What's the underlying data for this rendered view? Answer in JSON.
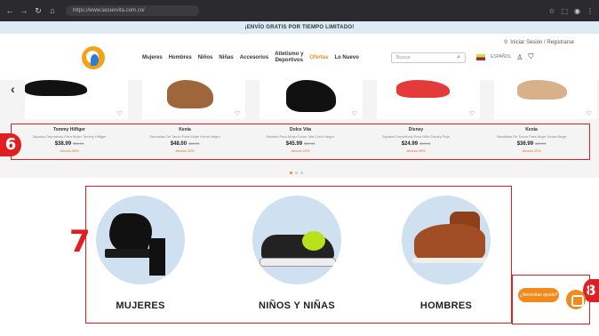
{
  "browser": {
    "url": "https://www.lacuervita.com.co/"
  },
  "promo": {
    "text": "¡ENVÍO GRATIS POR TIEMPO LIMITADO!"
  },
  "header": {
    "login_text": "Iniciar Sesión / Registrarse",
    "menu": [
      "Mujeres",
      "Hombres",
      "Niños",
      "Niñas",
      "Accesorios"
    ],
    "menu_stack": [
      "Atletismo y",
      "Deportivos"
    ],
    "menu_hot": "Ofertas",
    "menu_new": "Lo Nuevo",
    "search_placeholder": "Buscar",
    "language": "ESPAÑOL"
  },
  "carousel": {
    "products": [
      {
        "brand": "Tommy Hilfiger",
        "desc": "Zapatos Deportivos Para Mujer Tommy Hilfiger",
        "price": "$38.99",
        "old_price": "$59.99",
        "discount": "Ahorra 35%"
      },
      {
        "brand": "Kenia",
        "desc": "Sandalias De Tacón Para Mujer Kenia Negro",
        "price": "$48.00",
        "old_price": "$65.00",
        "discount": "Ahorra 26%"
      },
      {
        "brand": "Dolce Vita",
        "desc": "Botines Para Mujer Dolce Vita Color Negro",
        "price": "$45.99",
        "old_price": "$59.99",
        "discount": "Ahorra 23%"
      },
      {
        "brand": "Disney",
        "desc": "Zapatos Deportivos Para Niña Disney Rojo",
        "price": "$24.99",
        "old_price": "$34.99",
        "discount": "Ahorra 28%"
      },
      {
        "brand": "Kenia",
        "desc": "Sandalias De Tacón Para Mujer Kenia Beige",
        "price": "$36.99",
        "old_price": "$54.99",
        "discount": "Ahorra 32%"
      }
    ]
  },
  "annotations": {
    "six": "6",
    "seven": "7",
    "eight": "8"
  },
  "categories": [
    {
      "label": "MUJERES"
    },
    {
      "label": "NIÑOS Y NIÑAS"
    },
    {
      "label": "HOMBRES"
    }
  ],
  "widgets": {
    "help_label": "¿Necesitas ayuda?"
  },
  "colors": {
    "accent": "#f08a1c",
    "annotation": "#e02020",
    "banner": "#dcebf6",
    "circle": "#cfe0f0"
  }
}
